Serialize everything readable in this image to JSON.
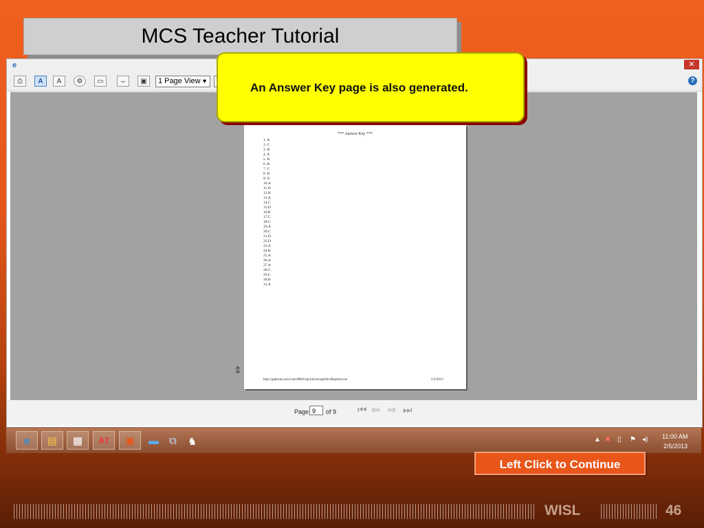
{
  "slide": {
    "title": "MCS Teacher Tutorial",
    "callout": "An Answer Key page is also generated.",
    "continue_label": "Left Click to Continue",
    "footer_brand": "WISL",
    "slide_number": "46"
  },
  "window": {
    "close_glyph": "✕",
    "icon": "ie-page-icon"
  },
  "toolbar": {
    "view_mode": "1 Page View",
    "help_glyph": "?"
  },
  "report_page": {
    "heading": "*** Answer Key ***",
    "answers": [
      "1. A",
      "2. C",
      "3. B",
      "4. A",
      "5. B",
      "6. B",
      "7. C",
      "8. B",
      "9. A",
      "10.A",
      "11.D",
      "12.B",
      "13.A",
      "14.C",
      "15.D",
      "16.B",
      "17.C",
      "18.C",
      "19.A",
      "20.C",
      "21.D",
      "22.D",
      "23.A",
      "24.B",
      "25.A",
      "26.A",
      "27.A",
      "28.C",
      "29.C",
      "30.B",
      "31.A"
    ],
    "footer_url": "http://gateway.wisl.com:8003/cgi-bin/mcsg6/mcsReports.exe",
    "footer_date": "2/5/2013"
  },
  "status": {
    "page_label": "Page",
    "page_value": "9",
    "page_total": "of 9"
  },
  "taskbar": {
    "clock_time": "11:00 AM",
    "clock_date": "2/5/2013"
  },
  "colors": {
    "slide_orange": "#e9561a",
    "callout_yellow": "#ffff00",
    "callout_shadow": "#8a0000",
    "viewer_gray": "#a2a2a2"
  }
}
